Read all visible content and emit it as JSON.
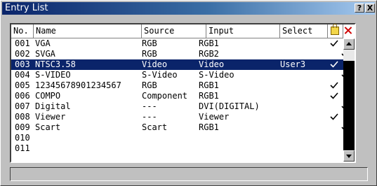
{
  "window": {
    "title": "Entry List",
    "help_label": "?",
    "close_label": "X"
  },
  "columns": {
    "no": "No.",
    "name": "Name",
    "source": "Source",
    "input": "Input",
    "select": "Select",
    "lock_icon": "lock-icon",
    "delete_icon": "delete-icon"
  },
  "rows": [
    {
      "no": "001",
      "name": "VGA",
      "source": "RGB",
      "input": "RGB1",
      "select": "",
      "lock": true,
      "delete": false,
      "selected": false
    },
    {
      "no": "002",
      "name": "SVGA",
      "source": "RGB",
      "input": "RGB2",
      "select": "",
      "lock": false,
      "delete": true,
      "selected": false
    },
    {
      "no": "003",
      "name": "NTSC3.58",
      "source": "Video",
      "input": "Video",
      "select": "User3",
      "lock": true,
      "delete": false,
      "selected": true
    },
    {
      "no": "004",
      "name": "S-VIDEO",
      "source": "S-Video",
      "input": "S-Video",
      "select": "",
      "lock": false,
      "delete": true,
      "selected": false
    },
    {
      "no": "005",
      "name": "12345678901234567",
      "source": "RGB",
      "input": "RGB1",
      "select": "",
      "lock": true,
      "delete": false,
      "selected": false
    },
    {
      "no": "006",
      "name": "COMPO",
      "source": "Component",
      "input": "RGB1",
      "select": "",
      "lock": true,
      "delete": false,
      "selected": false
    },
    {
      "no": "007",
      "name": "Digital",
      "source": "---",
      "input": "DVI(DIGITAL)",
      "select": "",
      "lock": false,
      "delete": true,
      "selected": false
    },
    {
      "no": "008",
      "name": "Viewer",
      "source": "---",
      "input": "Viewer",
      "select": "",
      "lock": true,
      "delete": false,
      "selected": false
    },
    {
      "no": "009",
      "name": "Scart",
      "source": "Scart",
      "input": "RGB1",
      "select": "",
      "lock": false,
      "delete": true,
      "selected": false
    },
    {
      "no": "010",
      "name": "",
      "source": "",
      "input": "",
      "select": "",
      "lock": false,
      "delete": false,
      "selected": false
    },
    {
      "no": "011",
      "name": "",
      "source": "",
      "input": "",
      "select": "",
      "lock": false,
      "delete": false,
      "selected": false
    }
  ],
  "status": {
    "text": ""
  }
}
